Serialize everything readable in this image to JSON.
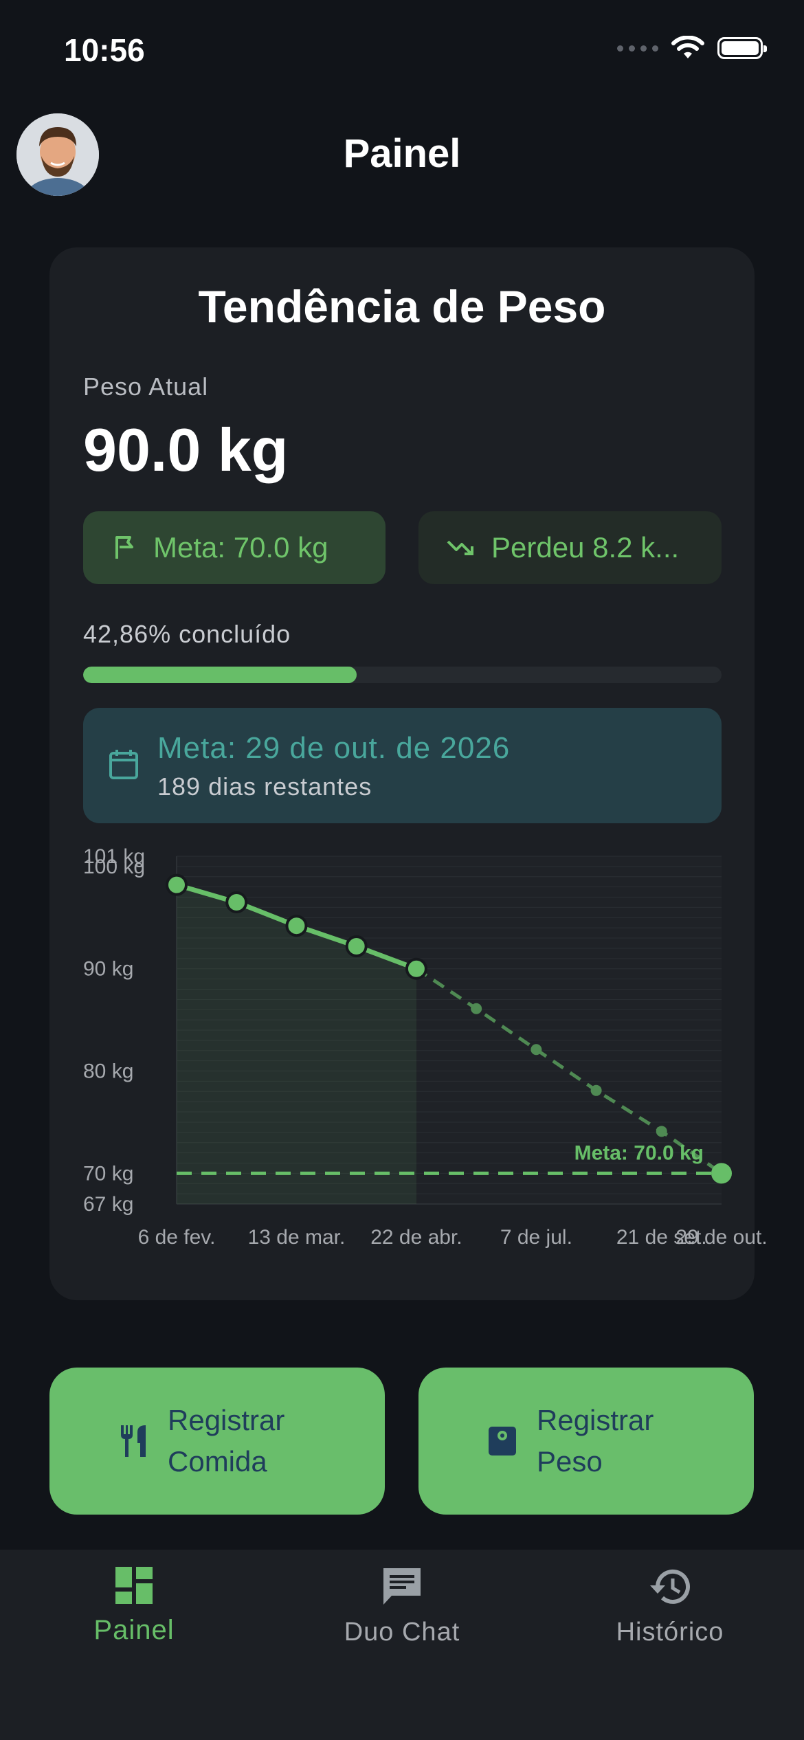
{
  "status_bar": {
    "time": "10:56"
  },
  "header": {
    "title": "Painel"
  },
  "card": {
    "title": "Tendência de Peso",
    "current_weight_label": "Peso Atual",
    "current_weight": "90.0 kg",
    "goal_chip": "Meta: 70.0 kg",
    "lost_chip": "Perdeu 8.2 k...",
    "progress_label": "42,86% concluído",
    "progress_fraction": 0.4286,
    "deadline_title": "Meta: 29 de out. de 2026",
    "deadline_subtitle": "189 dias restantes"
  },
  "chart_data": {
    "type": "line",
    "x": [
      "6 de fev.",
      "13 de mar.",
      "22 de abr.",
      "7 de jul.",
      "21 de set.",
      "29 de out."
    ],
    "y_ticks": [
      "101 kg",
      "100 kg",
      "90 kg",
      "80 kg",
      "70 kg",
      "67 kg"
    ],
    "ylim": [
      67,
      101
    ],
    "series": [
      {
        "values": [
          [
            0,
            98.2
          ],
          [
            0.11,
            96.5
          ],
          [
            0.22,
            94.2
          ],
          [
            0.33,
            92.2
          ],
          [
            0.44,
            90.0
          ]
        ]
      },
      {
        "values": [
          [
            0.44,
            90.0
          ],
          [
            0.55,
            86.1
          ],
          [
            0.66,
            82.1
          ],
          [
            0.77,
            78.1
          ],
          [
            0.89,
            74.1
          ],
          [
            1.0,
            70.0
          ]
        ]
      }
    ],
    "goal_value": 70,
    "goal_label": "Meta: 70.0 kg",
    "colors": {
      "line": "#67be68",
      "projection": "#4f8a53"
    }
  },
  "actions": {
    "log_food": "Registrar\nComida",
    "log_weight": "Registrar\nPeso"
  },
  "bottom_nav": {
    "items": [
      {
        "label": "Painel",
        "active": true
      },
      {
        "label": "Duo Chat",
        "active": false
      },
      {
        "label": "Histórico",
        "active": false
      }
    ]
  },
  "colors": {
    "accent": "#67be68",
    "background": "#111419",
    "card": "#1c1f24"
  }
}
